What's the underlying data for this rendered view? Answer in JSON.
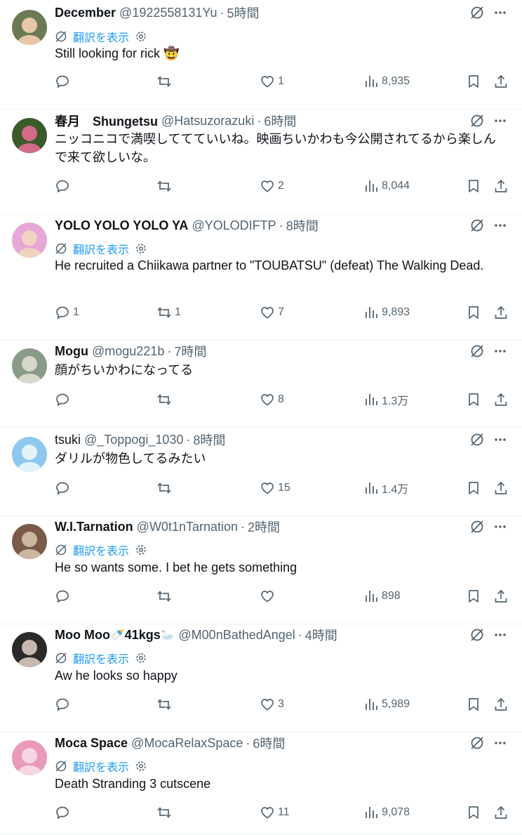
{
  "tweets": [
    {
      "name": "December",
      "bold": true,
      "emoji1": "",
      "name2": "",
      "emoji2": "",
      "handle": "@1922558131Yu",
      "time": "5時間",
      "translate": true,
      "translate_label": "翻訳を表示",
      "text": "Still looking for rick 🤠",
      "replies": "",
      "retweets": "",
      "likes": "1",
      "views": "8,935",
      "avatar_colors": [
        "#6b7a55",
        "#e8c7a8"
      ]
    },
    {
      "name": "春月　Shungetsu",
      "bold": true,
      "emoji1": "",
      "name2": "",
      "emoji2": "",
      "handle": "@Hatsuzorazuki",
      "time": "6時間",
      "translate": false,
      "translate_label": "",
      "text": "ニッコニコで満喫しててていいね。映画ちいかわも今公開されてるから楽しんで来て欲しいな。",
      "replies": "",
      "retweets": "",
      "likes": "2",
      "views": "8,044",
      "avatar_colors": [
        "#3a5a2a",
        "#d46a8a"
      ]
    },
    {
      "name": "YOLO YOLO YOLO YA",
      "bold": true,
      "emoji1": "",
      "name2": "",
      "emoji2": "",
      "handle": "@YOLODIFTP",
      "time": "8時間",
      "translate": true,
      "translate_label": "翻訳を表示",
      "text": "He recruited a Chiikawa partner to \"TOUBATSU\"  (defeat) The Walking Dead.",
      "replies": "1",
      "retweets": "1",
      "likes": "7",
      "views": "9,893",
      "avatar_colors": [
        "#e7a7d7",
        "#f0d2c0"
      ]
    },
    {
      "name": "Mogu",
      "bold": true,
      "emoji1": "",
      "name2": "",
      "emoji2": "",
      "handle": "@mogu221b",
      "time": "7時間",
      "translate": false,
      "translate_label": "",
      "text": "顔がちいかわになってる",
      "replies": "",
      "retweets": "",
      "likes": "8",
      "views": "1.3万",
      "avatar_colors": [
        "#8a9a88",
        "#d9d6cc"
      ]
    },
    {
      "name": "tsuki",
      "bold": false,
      "emoji1": "",
      "name2": "",
      "emoji2": "",
      "handle": "@_Toppogi_1030",
      "time": "8時間",
      "translate": false,
      "translate_label": "",
      "text": "ダリルが物色してるみたい",
      "replies": "",
      "retweets": "",
      "likes": "15",
      "views": "1.4万",
      "avatar_colors": [
        "#8fc8ee",
        "#e4f2fb"
      ]
    },
    {
      "name": "W.I.Tarnation",
      "bold": true,
      "emoji1": "",
      "name2": "",
      "emoji2": "",
      "handle": "@W0t1nTarnation",
      "time": "2時間",
      "translate": true,
      "translate_label": "翻訳を表示",
      "text": "He so wants some. I bet he gets something",
      "replies": "",
      "retweets": "",
      "likes": "",
      "views": "898",
      "avatar_colors": [
        "#7a5a48",
        "#cbb7a0"
      ]
    },
    {
      "name": "Moo Moo",
      "bold": true,
      "emoji1": "🍼",
      "name2": "41kgs",
      "emoji2": "🦢",
      "handle": "@M00nBathedAngel",
      "time": "4時間",
      "translate": true,
      "translate_label": "翻訳を表示",
      "text": "Aw he looks so happy",
      "replies": "",
      "retweets": "",
      "likes": "3",
      "views": "5,989",
      "avatar_colors": [
        "#2a2a2a",
        "#c9b8b0"
      ]
    },
    {
      "name": "Moca Space",
      "bold": true,
      "emoji1": "",
      "name2": "",
      "emoji2": "",
      "handle": "@MocaRelaxSpace",
      "time": "6時間",
      "translate": true,
      "translate_label": "翻訳を表示",
      "text": "Death Stranding 3 cutscene",
      "replies": "",
      "retweets": "",
      "likes": "11",
      "views": "9,078",
      "avatar_colors": [
        "#e99ab8",
        "#f6d6e2"
      ]
    }
  ],
  "colors": {
    "text": "#0f1419",
    "secondary": "#536471",
    "accent": "#1d9bf0",
    "divider": "#eff3f4"
  },
  "icons": {
    "grok": "grok-icon",
    "more": "more-icon",
    "reply": "reply-icon",
    "retweet": "retweet-icon",
    "like": "heart-icon",
    "views": "views-icon",
    "bookmark": "bookmark-icon",
    "share": "share-icon",
    "translate": "translate-icon",
    "settings": "gear-icon"
  }
}
